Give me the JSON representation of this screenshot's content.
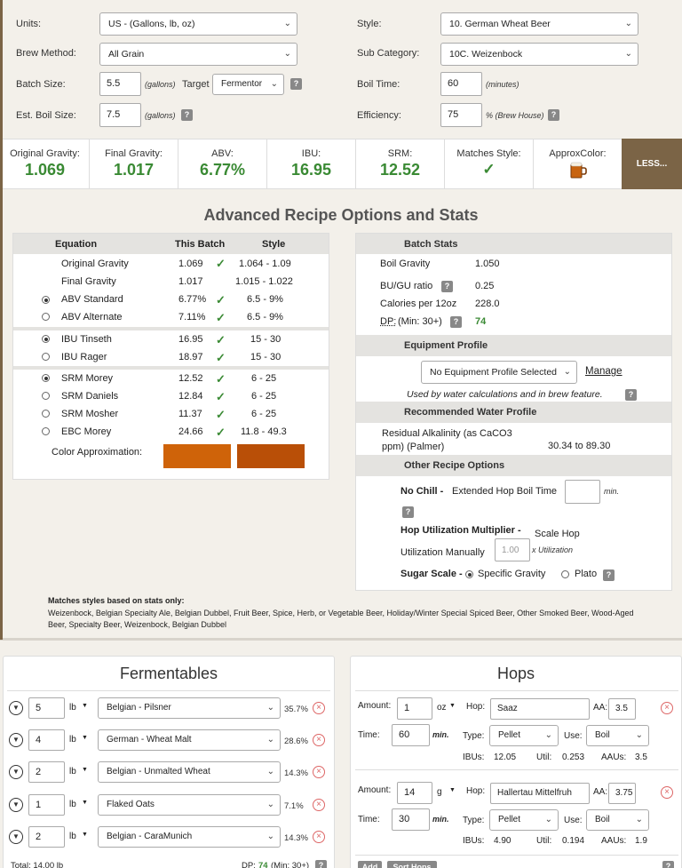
{
  "top": {
    "units_label": "Units:",
    "units_value": "US - (Gallons, lb, oz)",
    "brew_method_label": "Brew Method:",
    "brew_method_value": "All Grain",
    "batch_size_label": "Batch Size:",
    "batch_size_value": "5.5",
    "batch_size_unit": "(gallons)",
    "target_label": "Target",
    "target_value": "Fermentor",
    "est_boil_label": "Est. Boil Size:",
    "est_boil_value": "7.5",
    "est_boil_unit": "(gallons)",
    "style_label": "Style:",
    "style_value": "10. German Wheat Beer",
    "sub_category_label": "Sub Category:",
    "sub_category_value": "10C. Weizenbock",
    "boil_time_label": "Boil Time:",
    "boil_time_value": "60",
    "boil_time_unit": "(minutes)",
    "efficiency_label": "Efficiency:",
    "efficiency_value": "75",
    "efficiency_unit": "% (Brew House)",
    "help": "?"
  },
  "stats": [
    {
      "label": "Original Gravity:",
      "value": "1.069"
    },
    {
      "label": "Final Gravity:",
      "value": "1.017"
    },
    {
      "label": "ABV:",
      "value": "6.77%"
    },
    {
      "label": "IBU:",
      "value": "16.95"
    },
    {
      "label": "SRM:",
      "value": "12.52"
    },
    {
      "label": "Matches Style:",
      "value": "✓"
    },
    {
      "label": "ApproxColor:",
      "value": ""
    }
  ],
  "less_button": "LESS...",
  "advanced_title": "Advanced Recipe Options and Stats",
  "eq_table": {
    "headers": [
      "Equation",
      "This Batch",
      "Style"
    ],
    "rows": [
      {
        "name": "Original Gravity",
        "batch": "1.069",
        "style": "1.064 - 1.09"
      },
      {
        "name": "Final Gravity",
        "batch": "1.017",
        "style": "1.015 - 1.022"
      },
      {
        "name": "ABV Standard",
        "batch": "6.77%",
        "style": "6.5 - 9%"
      },
      {
        "name": "ABV Alternate",
        "batch": "7.11%",
        "style": "6.5 - 9%"
      },
      {
        "name": "IBU Tinseth",
        "batch": "16.95",
        "style": "15 - 30"
      },
      {
        "name": "IBU Rager",
        "batch": "18.97",
        "style": "15 - 30"
      },
      {
        "name": "SRM Morey",
        "batch": "12.52",
        "style": "6 - 25"
      },
      {
        "name": "SRM Daniels",
        "batch": "12.84",
        "style": "6 - 25"
      },
      {
        "name": "SRM Mosher",
        "batch": "11.37",
        "style": "6 - 25"
      },
      {
        "name": "EBC Morey",
        "batch": "24.66",
        "style": "11.8 - 49.3"
      }
    ],
    "color_label": "Color Approximation:",
    "color_batch": "#cf6309",
    "color_style": "#b94f07"
  },
  "batch_stats": {
    "title": "Batch Stats",
    "boil_gravity_label": "Boil Gravity",
    "boil_gravity_value": "1.050",
    "bugu_label": "BU/GU ratio",
    "bugu_value": "0.25",
    "calories_label": "Calories per 12oz",
    "calories_value": "228.0",
    "dp_label": "DP:",
    "dp_min": "(Min: 30+)",
    "dp_value": "74",
    "equipment_title": "Equipment Profile",
    "equipment_value": "No Equipment Profile Selected",
    "manage_link": "Manage",
    "equipment_note": "Used by water calculations and in brew feature.",
    "water_title": "Recommended Water Profile",
    "residual_label": "Residual Alkalinity (as CaCO3 ppm) (Palmer)",
    "residual_value": "30.34 to 89.30",
    "other_title": "Other Recipe Options",
    "no_chill_label": "No Chill -",
    "no_chill_text": "Extended Hop Boil Time",
    "no_chill_unit": "min.",
    "hop_util_label": "Hop Utilization Multiplier -",
    "hop_util_text": "Scale Hop Utilization Manually",
    "hop_util_value": "1.00",
    "hop_util_unit": "x Utilization",
    "sugar_label": "Sugar Scale -",
    "sugar_opt1": "Specific Gravity",
    "sugar_opt2": "Plato"
  },
  "matches": {
    "title": "Matches styles based on stats only:",
    "text": "Weizenbock, Belgian Specialty Ale, Belgian Dubbel, Fruit Beer, Spice, Herb, or Vegetable Beer, Holiday/Winter Special Spiced Beer, Other Smoked Beer, Wood-Aged Beer, Specialty Beer, Weizenbock, Belgian Dubbel"
  },
  "fermentables": {
    "title": "Fermentables",
    "items": [
      {
        "amount": "5",
        "unit": "lb",
        "name": "Belgian - Pilsner",
        "pct": "35.7%"
      },
      {
        "amount": "4",
        "unit": "lb",
        "name": "German - Wheat Malt",
        "pct": "28.6%"
      },
      {
        "amount": "2",
        "unit": "lb",
        "name": "Belgian - Unmalted Wheat",
        "pct": "14.3%"
      },
      {
        "amount": "1",
        "unit": "lb",
        "name": "Flaked Oats",
        "pct": "7.1%"
      },
      {
        "amount": "2",
        "unit": "lb",
        "name": "Belgian - CaraMunich",
        "pct": "14.3%"
      }
    ],
    "total": "Total: 14.00 lb",
    "dp_label": "DP:",
    "dp_value": "74",
    "dp_min": "(Min: 30+)"
  },
  "hops": {
    "title": "Hops",
    "amount_label": "Amount:",
    "hop_label": "Hop:",
    "aa_label": "AA:",
    "time_label": "Time:",
    "min_label": "min.",
    "type_label": "Type:",
    "use_label": "Use:",
    "ibus_label": "IBUs:",
    "util_label": "Util:",
    "aaus_label": "AAUs:",
    "items": [
      {
        "amount": "1",
        "unit": "oz",
        "name": "Saaz",
        "aa": "3.5",
        "time": "60",
        "type": "Pellet",
        "use": "Boil",
        "ibus": "12.05",
        "util": "0.253",
        "aaus": "3.5"
      },
      {
        "amount": "14",
        "unit": "g",
        "name": "Hallertau Mittelfruh",
        "aa": "3.75",
        "time": "30",
        "type": "Pellet",
        "use": "Boil",
        "ibus": "4.90",
        "util": "0.194",
        "aaus": "1.9"
      }
    ],
    "add_button": "Add",
    "sort_button": "Sort Hops"
  }
}
